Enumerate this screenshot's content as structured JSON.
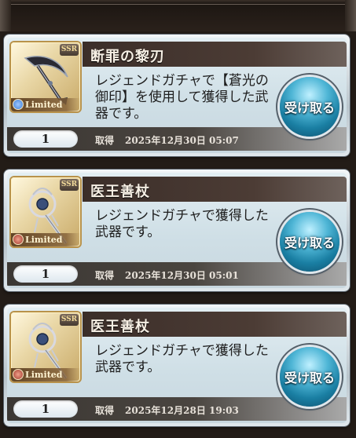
{
  "rewards": [
    {
      "title": "断罪の黎刃",
      "description": "レジェンドガチャで【蒼光の御印】を使用して獲得した武器です。",
      "quantity": "1",
      "acquired_label": "取得",
      "acquired_date": "2025年12月30日 05:07",
      "rarity": "SSR",
      "limited_label": "Limited",
      "receive_label": "受け取る",
      "element_color": "#3f7fd6",
      "weapon_icon": "scythe-blade-icon"
    },
    {
      "title": "医王善杖",
      "description": "レジェンドガチャで獲得した武器です。",
      "quantity": "1",
      "acquired_label": "取得",
      "acquired_date": "2025年12月30日 05:01",
      "rarity": "SSR",
      "limited_label": "Limited",
      "receive_label": "受け取る",
      "element_color": "#a23a2e",
      "weapon_icon": "staff-icon"
    },
    {
      "title": "医王善杖",
      "description": "レジェンドガチャで獲得した武器です。",
      "quantity": "1",
      "acquired_label": "取得",
      "acquired_date": "2025年12月28日 19:03",
      "rarity": "SSR",
      "limited_label": "Limited",
      "receive_label": "受け取る",
      "element_color": "#a23a2e",
      "weapon_icon": "staff-icon"
    }
  ]
}
